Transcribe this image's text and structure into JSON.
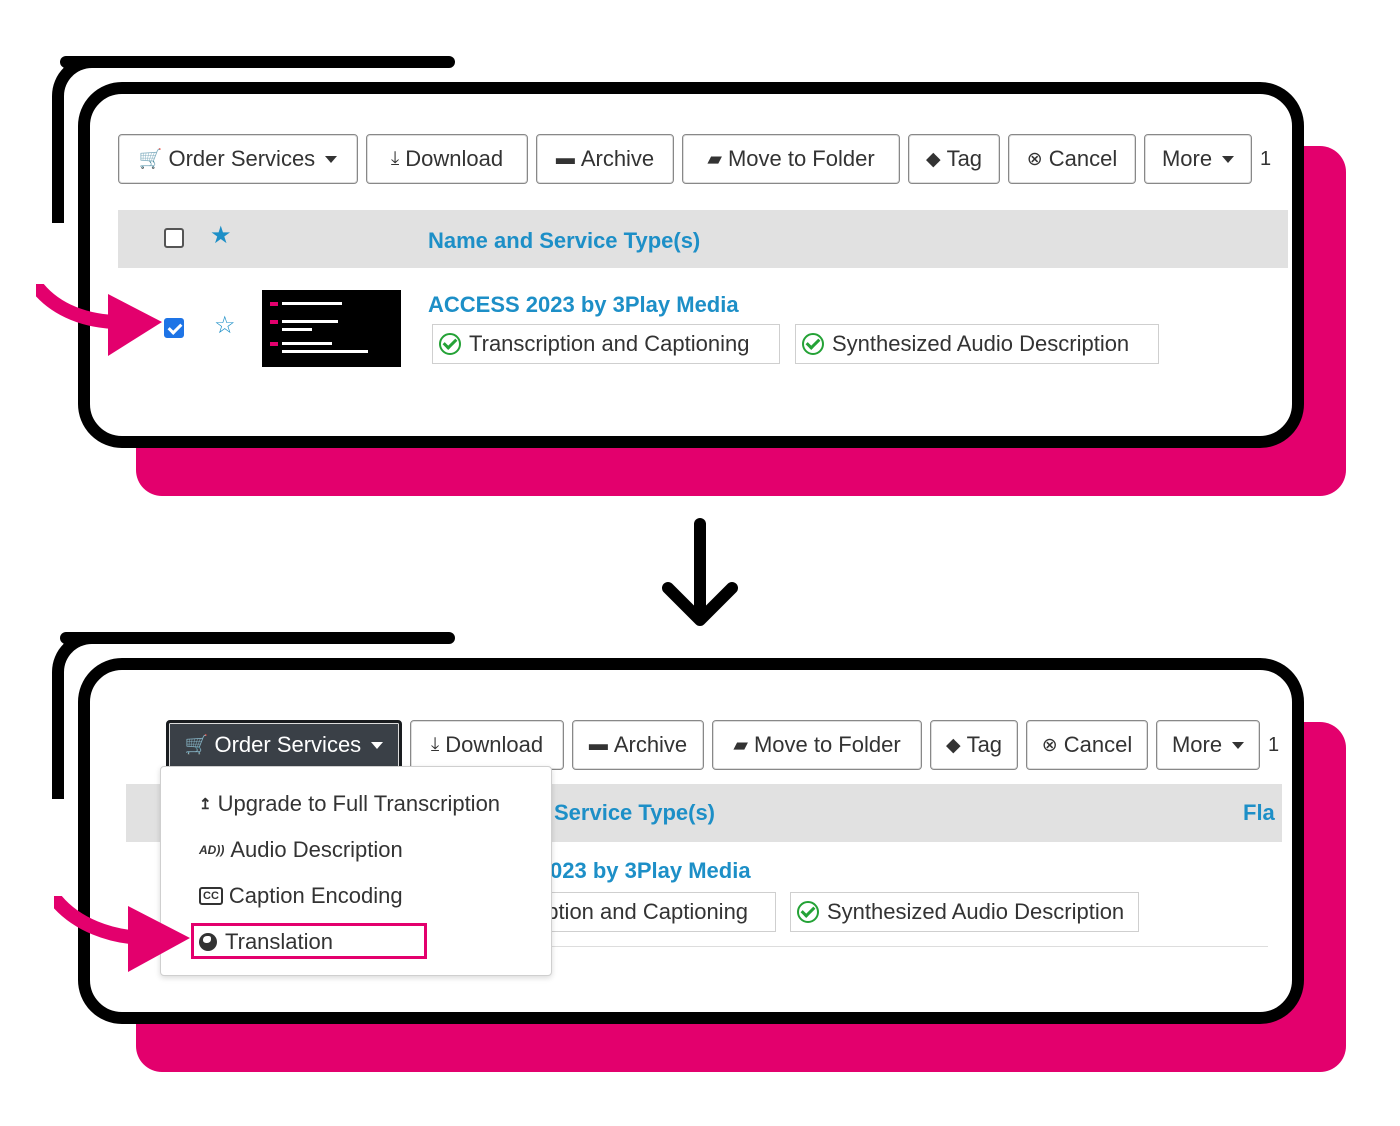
{
  "colors": {
    "accent": "#e3006d",
    "link": "#1d8fc7",
    "check": "#24a236",
    "header_row": "#e1e1e1",
    "dark_button": "#3a4047"
  },
  "toolbar": {
    "order_services": "Order Services",
    "download": "Download",
    "archive": "Archive",
    "move_to_folder": "Move to Folder",
    "tag": "Tag",
    "cancel": "Cancel",
    "more": "More",
    "count_fragment": "1"
  },
  "icons": {
    "order_services": "cart-icon",
    "download": "download-icon",
    "archive": "archive-icon",
    "move_to_folder": "folder-open-icon",
    "tag": "tag-icon",
    "cancel": "times-circle-icon",
    "more": "caret-down-icon"
  },
  "table": {
    "column_name": "Name and Service Type(s)",
    "column_name_partial": "Service Type(s)",
    "column_flag_partial": "Fla"
  },
  "row": {
    "title": "ACCESS 2023 by 3Play Media",
    "title_partial": "023 by 3Play Media",
    "selected": true,
    "services": [
      "Transcription and Captioning",
      "Synthesized Audio Description"
    ],
    "service_partial": "ription and Captioning"
  },
  "dropdown": {
    "items": [
      "Upgrade to Full Transcription",
      "Audio Description",
      "Caption Encoding",
      "Translation"
    ],
    "highlighted": "Translation"
  }
}
